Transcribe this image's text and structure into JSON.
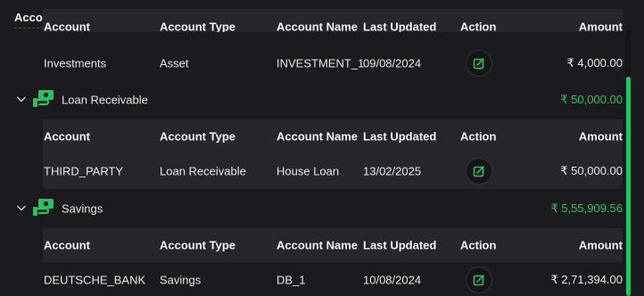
{
  "title": "Accounts",
  "accent": "#22c55e",
  "columns": [
    "Account",
    "Account Type",
    "Account Name",
    "Last Updated",
    "Action",
    "Amount"
  ],
  "top_row": {
    "account": "Investments",
    "type": "Asset",
    "name": "INVESTMENT_1",
    "updated": "09/08/2024",
    "amount": "₹ 4,000.00"
  },
  "groups": [
    {
      "name": "Loan Receivable",
      "total": "₹ 50,000.00",
      "row": {
        "account": "THIRD_PARTY",
        "type": "Loan Receivable",
        "name": "House Loan",
        "updated": "13/02/2025",
        "amount": "₹ 50,000.00"
      }
    },
    {
      "name": "Savings",
      "total": "₹ 5,55,909.56",
      "row": {
        "account": "DEUTSCHE_BANK",
        "type": "Savings",
        "name": "DB_1",
        "updated": "10/08/2024",
        "amount": "₹ 2,71,394.00"
      }
    }
  ],
  "icons": {
    "group": "money-hand-icon",
    "expand": "chevron-down-icon",
    "edit": "edit-icon"
  }
}
